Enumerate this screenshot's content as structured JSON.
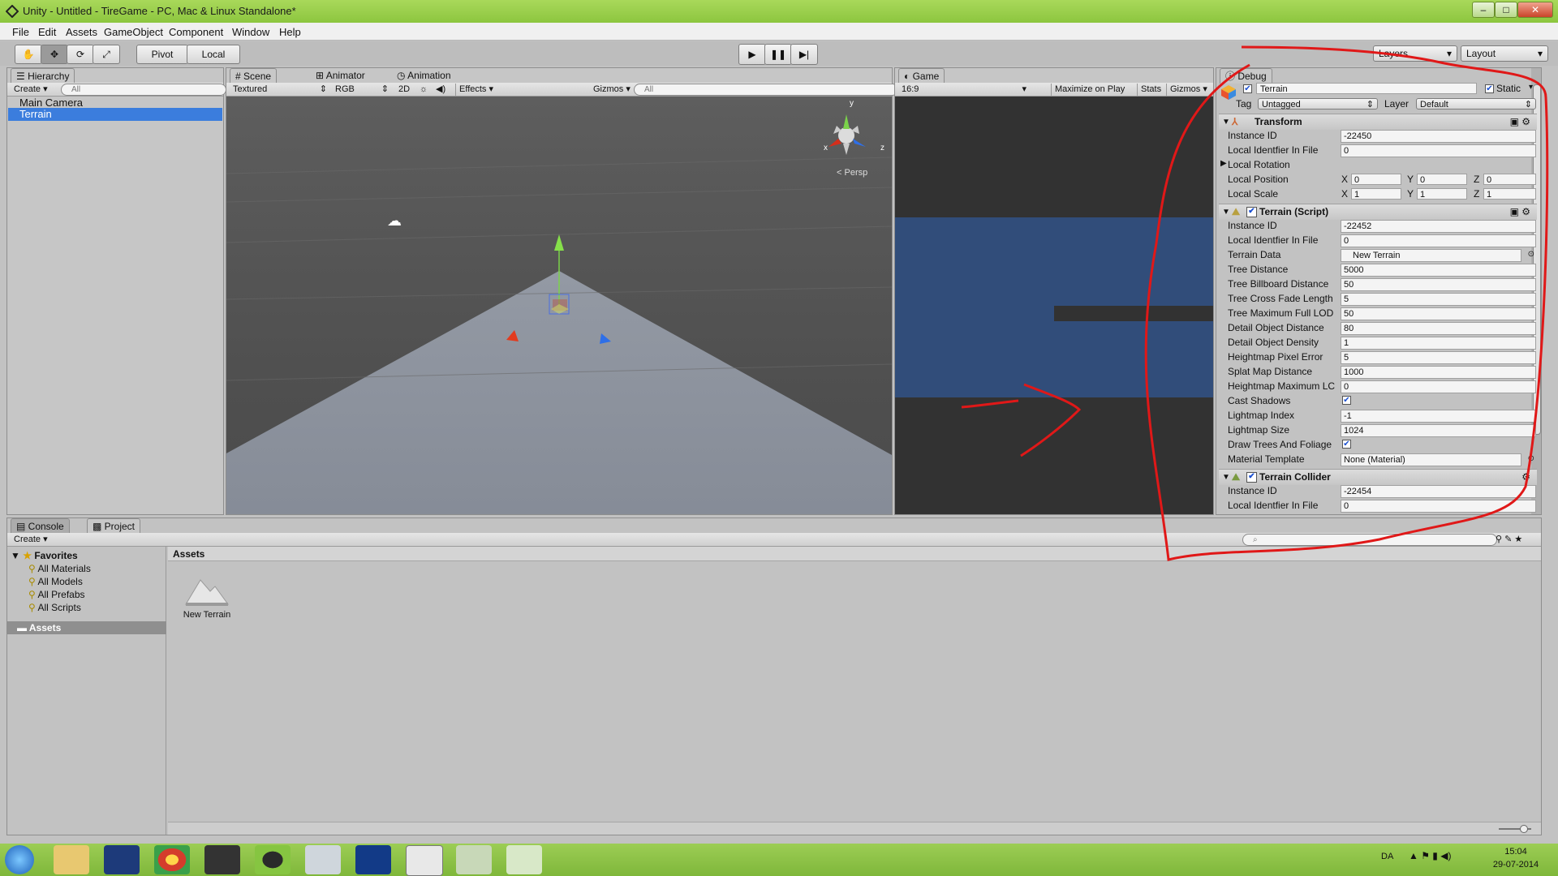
{
  "window": {
    "title": "Unity - Untitled - TireGame - PC, Mac & Linux Standalone*"
  },
  "menu": [
    "File",
    "Edit",
    "Assets",
    "GameObject",
    "Component",
    "Window",
    "Help"
  ],
  "toolbar": {
    "pivot": "Pivot",
    "local": "Local",
    "layers": "Layers",
    "layout": "Layout"
  },
  "hierarchy": {
    "tab": "Hierarchy",
    "create": "Create",
    "search_placeholder": "All",
    "items": [
      "Main Camera",
      "Terrain"
    ],
    "selected": "Terrain"
  },
  "scene": {
    "tabs": [
      "Scene",
      "Animator",
      "Animation"
    ],
    "shading": "Textured",
    "render": "RGB",
    "mode2d": "2D",
    "effects": "Effects",
    "gizmos": "Gizmos",
    "search_placeholder": "All",
    "gizmo_axes": {
      "y": "y",
      "x": "x",
      "z": "z"
    },
    "persp": "Persp"
  },
  "game": {
    "tab": "Game",
    "aspect": "16:9",
    "maximize": "Maximize on Play",
    "stats": "Stats",
    "gizmos": "Gizmos"
  },
  "inspector": {
    "tab": "Debug",
    "object_name": "Terrain",
    "static_label": "Static",
    "tag_label": "Tag",
    "tag_value": "Untagged",
    "layer_label": "Layer",
    "layer_value": "Default",
    "transform": {
      "title": "Transform",
      "rows": [
        {
          "label": "Instance ID",
          "value": "-22450"
        },
        {
          "label": "Local Identfier In File",
          "value": "0"
        }
      ],
      "rotation_label": "Local Rotation",
      "position": {
        "label": "Local Position",
        "x": "0",
        "y": "0",
        "z": "0"
      },
      "scale": {
        "label": "Local Scale",
        "x": "1",
        "y": "1",
        "z": "1"
      }
    },
    "terrain_script": {
      "title": "Terrain (Script)",
      "rows": [
        {
          "label": "Instance ID",
          "value": "-22452"
        },
        {
          "label": "Local Identfier In File",
          "value": "0"
        },
        {
          "label": "Terrain Data",
          "value": "New Terrain"
        },
        {
          "label": "Tree Distance",
          "value": "5000"
        },
        {
          "label": "Tree Billboard Distance",
          "value": "50"
        },
        {
          "label": "Tree Cross Fade Length",
          "value": "5"
        },
        {
          "label": "Tree Maximum Full LOD",
          "value": "50"
        },
        {
          "label": "Detail Object Distance",
          "value": "80"
        },
        {
          "label": "Detail Object Density",
          "value": "1"
        },
        {
          "label": "Heightmap Pixel Error",
          "value": "5"
        },
        {
          "label": "Splat Map Distance",
          "value": "1000"
        },
        {
          "label": "Heightmap Maximum LC",
          "value": "0"
        }
      ],
      "cast_shadows": "Cast Shadows",
      "rows2": [
        {
          "label": "Lightmap Index",
          "value": "-1"
        },
        {
          "label": "Lightmap Size",
          "value": "1024"
        }
      ],
      "draw_trees": "Draw Trees And Foliage",
      "material": {
        "label": "Material Template",
        "value": "None (Material)"
      }
    },
    "terrain_collider": {
      "title": "Terrain Collider",
      "rows": [
        {
          "label": "Instance ID",
          "value": "-22454"
        },
        {
          "label": "Local Identfier In File",
          "value": "0"
        }
      ]
    }
  },
  "bottom": {
    "tabs": [
      "Console",
      "Project"
    ],
    "create": "Create",
    "favorites": "Favorites",
    "favorite_items": [
      "All Materials",
      "All Models",
      "All Prefabs",
      "All Scripts"
    ],
    "assets_folder": "Assets",
    "breadcrumb": "Assets",
    "asset_items": [
      "New Terrain"
    ]
  },
  "taskbar": {
    "lang": "DA",
    "time": "15:04",
    "date": "29-07-2014"
  }
}
